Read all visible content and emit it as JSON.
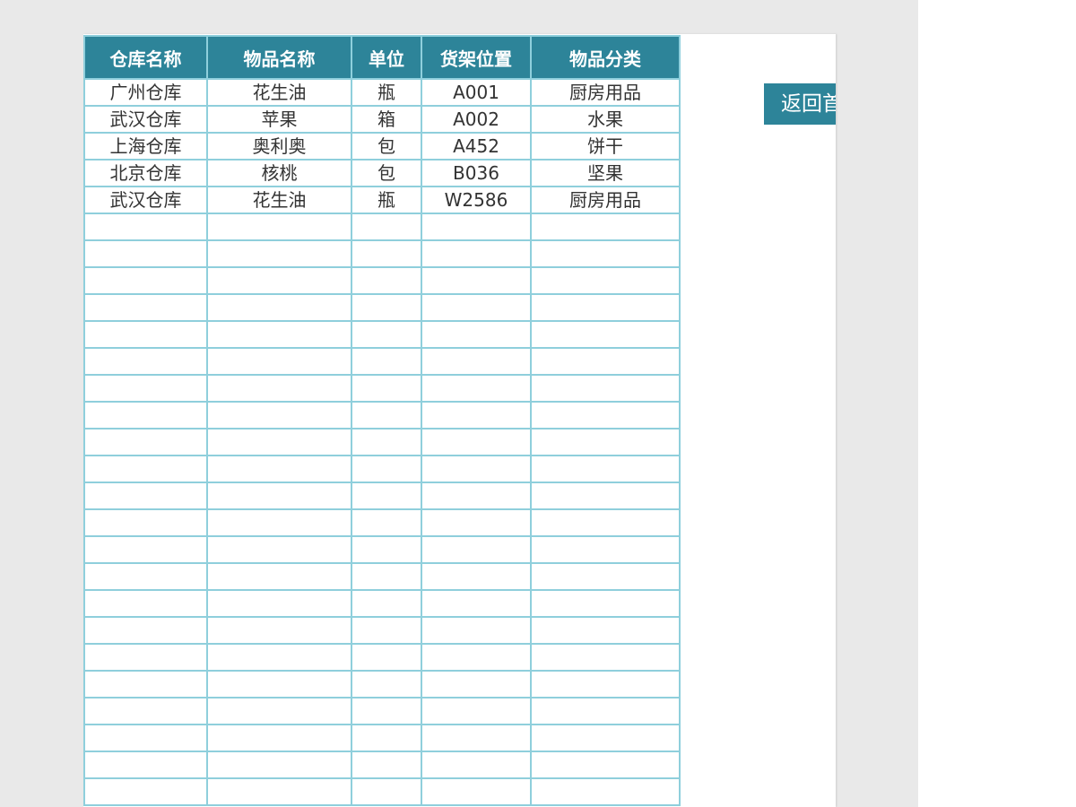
{
  "table": {
    "headers": [
      "仓库名称",
      "物品名称",
      "单位",
      "货架位置",
      "物品分类"
    ],
    "rows": [
      [
        "广州仓库",
        "花生油",
        "瓶",
        "A001",
        "厨房用品"
      ],
      [
        "武汉仓库",
        "苹果",
        "箱",
        "A002",
        "水果"
      ],
      [
        "上海仓库",
        "奥利奥",
        "包",
        "A452",
        "饼干"
      ],
      [
        "北京仓库",
        "核桃",
        "包",
        "B036",
        "坚果"
      ],
      [
        "武汉仓库",
        "花生油",
        "瓶",
        "W2586",
        "厨房用品"
      ]
    ],
    "empty_rows": 22
  },
  "home_button": {
    "label": "返回首页"
  },
  "colors": {
    "header_bg": "#2d8499",
    "header_text": "#ffffff",
    "grid_line": "#8fcfdc",
    "cell_text": "#333333",
    "workspace_bg": "#e9e9e9"
  }
}
